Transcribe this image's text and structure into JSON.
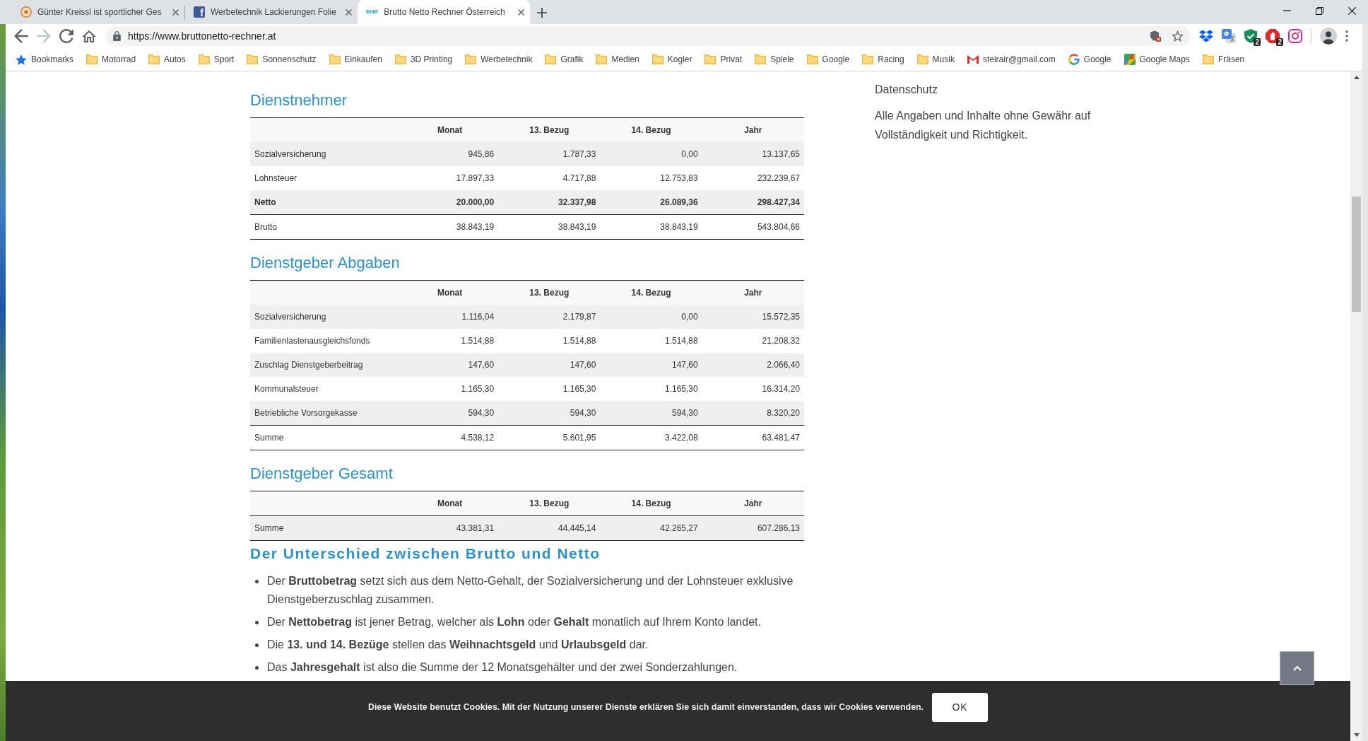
{
  "browser": {
    "tabs": [
      {
        "favicon": {
          "kind": "emblem"
        },
        "title": "Günter Kreissl ist sportlicher Ges",
        "selected": false
      },
      {
        "favicon": {
          "kind": "square-letter",
          "text": "f"
        },
        "title": "Werbetechnik Lackierungen Folie",
        "selected": false
      },
      {
        "favicon": {
          "kind": "text-logo",
          "text": "BNR"
        },
        "title": "Brutto Netto Rechner Österreich",
        "selected": true
      }
    ],
    "nav_buttons": [
      {
        "kind": "back",
        "disabled": false
      },
      {
        "kind": "forward",
        "disabled": true
      },
      {
        "kind": "reload",
        "disabled": false
      },
      {
        "kind": "home",
        "disabled": false
      }
    ],
    "address_bar": {
      "url": "https://www.bruttonetto-rechner.at",
      "bookmarked": false
    },
    "extensions": [
      {
        "kind": "box"
      },
      {
        "kind": "translate"
      },
      {
        "kind": "shield",
        "badge": "2"
      },
      {
        "kind": "stop",
        "badge": "2"
      },
      {
        "kind": "camera"
      }
    ],
    "bookmarks": [
      {
        "kind": "star",
        "label": "Bookmarks"
      },
      {
        "kind": "folder",
        "label": "Motorrad"
      },
      {
        "kind": "folder",
        "label": "Autos"
      },
      {
        "kind": "folder",
        "label": "Sport"
      },
      {
        "kind": "folder",
        "label": "Sonnenschutz"
      },
      {
        "kind": "folder",
        "label": "Einkaufen"
      },
      {
        "kind": "folder",
        "label": "3D Printing"
      },
      {
        "kind": "folder",
        "label": "Werbetechnik"
      },
      {
        "kind": "folder",
        "label": "Grafik"
      },
      {
        "kind": "folder",
        "label": "Medien"
      },
      {
        "kind": "folder",
        "label": "Kogler"
      },
      {
        "kind": "folder",
        "label": "Privat"
      },
      {
        "kind": "folder",
        "label": "Spiele"
      },
      {
        "kind": "folder",
        "label": "Google"
      },
      {
        "kind": "folder",
        "label": "Racing"
      },
      {
        "kind": "folder",
        "label": "Musik"
      },
      {
        "kind": "mail",
        "label": "steirair@gmail.com"
      },
      {
        "kind": "google",
        "label": "Google"
      },
      {
        "kind": "map",
        "label": "Google Maps"
      },
      {
        "kind": "folder",
        "label": "Fräsen"
      }
    ]
  },
  "page": {
    "tables": [
      {
        "heading": "Dienstnehmer",
        "columns": [
          "Monat",
          "13. Bezug",
          "14. Bezug",
          "Jahr"
        ],
        "rows": [
          {
            "label": "Sozialversicherung",
            "kind": "item",
            "values": [
              "945,86",
              "1.787,33",
              "0,00",
              "13.137,65"
            ]
          },
          {
            "label": "Lohnsteuer",
            "kind": "item",
            "values": [
              "17.897,33",
              "4.717,88",
              "12.753,83",
              "232.239,67"
            ]
          },
          {
            "label": "Netto",
            "kind": "result",
            "values": [
              "20.000,00",
              "32.337,98",
              "26.089,36",
              "298.427,34"
            ]
          },
          {
            "label": "Brutto",
            "kind": "total",
            "values": [
              "38.843,19",
              "38.843,19",
              "38.843,19",
              "543.804,66"
            ]
          }
        ]
      },
      {
        "heading": "Dienstgeber Abgaben",
        "columns": [
          "Monat",
          "13. Bezug",
          "14. Bezug",
          "Jahr"
        ],
        "rows": [
          {
            "label": "Sozialversicherung",
            "kind": "item",
            "values": [
              "1.116,04",
              "2.179,87",
              "0,00",
              "15.572,35"
            ]
          },
          {
            "label": "Familienlastenausgleichsfonds",
            "kind": "item",
            "values": [
              "1.514,88",
              "1.514,88",
              "1.514,88",
              "21.208,32"
            ]
          },
          {
            "label": "Zuschlag Dienstgeberbeitrag",
            "kind": "item",
            "values": [
              "147,60",
              "147,60",
              "147,60",
              "2.066,40"
            ]
          },
          {
            "label": "Kommunalsteuer",
            "kind": "item",
            "values": [
              "1.165,30",
              "1.165,30",
              "1.165,30",
              "16.314,20"
            ]
          },
          {
            "label": "Betriebliche Vorsorgekasse",
            "kind": "item",
            "values": [
              "594,30",
              "594,30",
              "594,30",
              "8.320,20"
            ]
          },
          {
            "label": "Summe",
            "kind": "total",
            "values": [
              "4.538,12",
              "5.601,95",
              "3.422,08",
              "63.481,47"
            ]
          }
        ]
      },
      {
        "heading": "Dienstgeber Gesamt",
        "columns": [
          "Monat",
          "13. Bezug",
          "14. Bezug",
          "Jahr"
        ],
        "rows": [
          {
            "label": "Summe",
            "kind": "total",
            "values": [
              "43.381,31",
              "44.445,14",
              "42.265,27",
              "607.286,13"
            ]
          }
        ]
      }
    ],
    "difference": {
      "heading": "Der Unterschied zwischen Brutto und Netto",
      "items": [
        {
          "text": "Der **Bruttobetrag** setzt sich aus dem Netto-Gehalt, der Sozialversicherung und der Lohnsteuer exklusive Dienstgeberzuschlag zusammen."
        },
        {
          "text": "Der **Nettobetrag** ist jener Betrag, welcher als **Lohn** oder **Gehalt** monatlich auf Ihrem Konto landet."
        },
        {
          "text": "Die **13. und 14. Bezüge** stellen das **Weihnachtsgeld** und **Urlaubsgeld** dar."
        },
        {
          "text": "Das **Jahresgehalt** ist also die Summe der 12 Monatsgehälter und der zwei Sonderzahlungen."
        }
      ]
    },
    "sidebar": {
      "links": [
        "Datenschutz"
      ],
      "note": "Alle Angaben und Inhalte ohne Gewähr auf Vollständigkeit und Richtigkeit."
    }
  },
  "cookie_banner": {
    "message": "Diese Website benutzt Cookies. Mit der Nutzung unserer Dienste erklären Sie sich damit einverstanden, dass wir Cookies verwenden.",
    "button": "OK"
  }
}
